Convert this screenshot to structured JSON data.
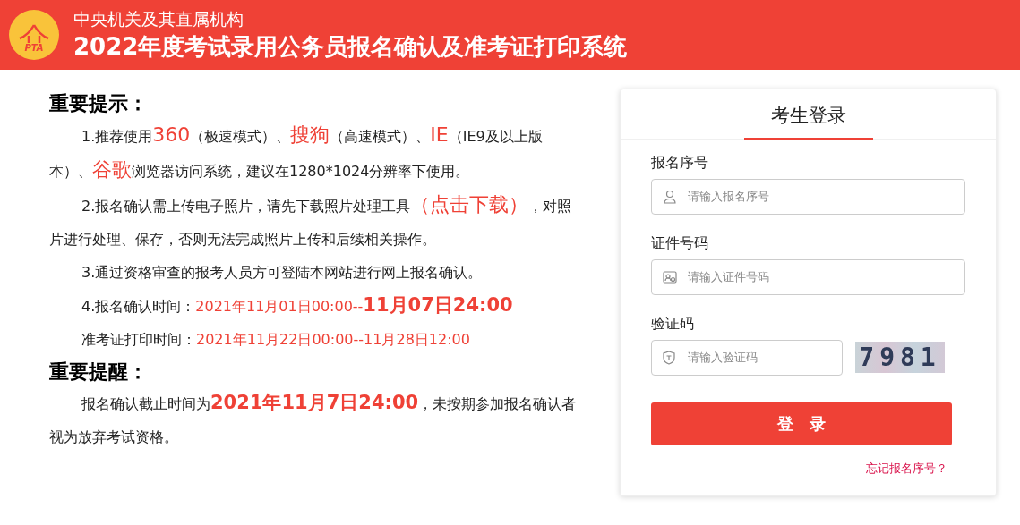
{
  "header": {
    "logo_text": "PTA",
    "subtitle": "中央机关及其直属机构",
    "title": "2022年度考试录用公务员报名确认及准考证打印系统"
  },
  "notice": {
    "heading": "重要提示：",
    "paragraphs": [
      {
        "segments": [
          {
            "kind": "plain",
            "text": "1.推荐使用"
          },
          {
            "kind": "big",
            "text": "360"
          },
          {
            "kind": "plain",
            "text": "（极速模式）、"
          },
          {
            "kind": "big",
            "text": "搜狗"
          },
          {
            "kind": "plain",
            "text": "（高速模式）、"
          },
          {
            "kind": "big",
            "text": "IE"
          },
          {
            "kind": "plain",
            "text": "（IE9及以上版本）、"
          },
          {
            "kind": "big",
            "text": "谷歌"
          },
          {
            "kind": "plain",
            "text": "浏览器访问系统，建议在1280*1024分辨率下使用。"
          }
        ]
      },
      {
        "segments": [
          {
            "kind": "plain",
            "text": "2.报名确认需上传电子照片，请先下载照片处理工具"
          },
          {
            "kind": "link",
            "text": "（点击下载）"
          },
          {
            "kind": "plain",
            "text": "，对照片进行处理、保存，否则无法完成照片上传和后续相关操作。"
          }
        ]
      },
      {
        "segments": [
          {
            "kind": "plain",
            "text": "3.通过资格审查的报考人员方可登陆本网站进行网上报名确认。"
          }
        ]
      },
      {
        "segments": [
          {
            "kind": "plain",
            "text": "4.报名确认时间："
          },
          {
            "kind": "red",
            "text": "2021年11月01日00:00--"
          },
          {
            "kind": "red_bold",
            "text": "11月07日24:00"
          }
        ]
      },
      {
        "segments": [
          {
            "kind": "plain",
            "text": "准考证打印时间："
          },
          {
            "kind": "red",
            "text": "2021年11月22日00:00--11月28日12:00"
          }
        ]
      }
    ]
  },
  "reminder": {
    "heading": "重要提醒：",
    "paragraphs": [
      {
        "segments": [
          {
            "kind": "plain",
            "text": "报名确认截止时间为"
          },
          {
            "kind": "red_bold",
            "text": "2021年11月7日24:00"
          },
          {
            "kind": "plain",
            "text": "，未按期参加报名确认者视为放弃考试资格。"
          }
        ]
      }
    ]
  },
  "login": {
    "title": "考生登录",
    "fields": [
      {
        "label": "报名序号",
        "placeholder": "请输入报名序号",
        "kind": "user"
      },
      {
        "label": "证件号码",
        "placeholder": "请输入证件号码",
        "kind": "id"
      },
      {
        "label": "验证码",
        "placeholder": "请输入验证码",
        "kind": "captcha"
      }
    ],
    "captcha_text": "7981",
    "submit": "登　录",
    "forgot_link": "忘记报名序号？"
  }
}
